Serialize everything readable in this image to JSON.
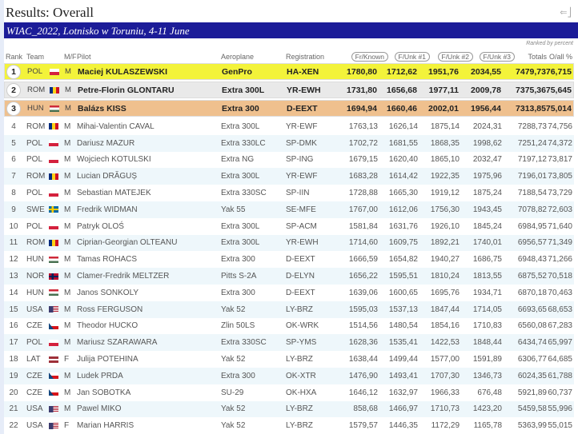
{
  "page": {
    "title": "Results: Overall",
    "exit_icon": "exit-icon",
    "banner": "WIAC_2022, Lotnisko w Toruniu, 4-11 June",
    "ranked_by": "Ranked by percent"
  },
  "colors": {
    "banner": "#1c1c98",
    "gold": "#f3f33a",
    "silver": "#e9e9e9",
    "bronze": "#efc08e",
    "alt_row": "#eef7fb"
  },
  "headers": {
    "rank": "Rank",
    "team": "Team",
    "mf": "M/F",
    "pilot": "Pilot",
    "aero": "Aeroplane",
    "reg": "Registration",
    "n1": "Fr/Known",
    "n2": "F/Unk #1",
    "n3": "F/Unk #2",
    "n4": "F/Unk #3",
    "tot": "Totals",
    "pct": "O/all %"
  },
  "rows": [
    [
      "1",
      "POL",
      "M",
      "Maciej KULASZEWSKI",
      "GenPro",
      "HA-XEN",
      "1780,80",
      "1712,62",
      "1951,76",
      "2034,55",
      "7479,73",
      "76,715"
    ],
    [
      "2",
      "ROM",
      "M",
      "Petre-Florin GLONTARU",
      "Extra 300L",
      "YR-EWH",
      "1731,80",
      "1656,68",
      "1977,11",
      "2009,78",
      "7375,36",
      "75,645"
    ],
    [
      "3",
      "HUN",
      "M",
      "Balázs KISS",
      "Extra 300",
      "D-EEXT",
      "1694,94",
      "1660,46",
      "2002,01",
      "1956,44",
      "7313,85",
      "75,014"
    ],
    [
      "4",
      "ROM",
      "M",
      "Mihai-Valentin CAVAL",
      "Extra 300L",
      "YR-EWF",
      "1763,13",
      "1626,14",
      "1875,14",
      "2024,31",
      "7288,73",
      "74,756"
    ],
    [
      "5",
      "POL",
      "M",
      "Dariusz MAZUR",
      "Extra 330LC",
      "SP-DMK",
      "1702,72",
      "1681,55",
      "1868,35",
      "1998,62",
      "7251,24",
      "74,372"
    ],
    [
      "6",
      "POL",
      "M",
      "Wojciech KOTULSKI",
      "Extra NG",
      "SP-ING",
      "1679,15",
      "1620,40",
      "1865,10",
      "2032,47",
      "7197,12",
      "73,817"
    ],
    [
      "7",
      "ROM",
      "M",
      "Lucian DRĂGUȘ",
      "Extra 300L",
      "YR-EWF",
      "1683,28",
      "1614,42",
      "1922,35",
      "1975,96",
      "7196,01",
      "73,805"
    ],
    [
      "8",
      "POL",
      "M",
      "Sebastian MATEJEK",
      "Extra 330SC",
      "SP-IIN",
      "1728,88",
      "1665,30",
      "1919,12",
      "1875,24",
      "7188,54",
      "73,729"
    ],
    [
      "9",
      "SWE",
      "M",
      "Fredrik WIDMAN",
      "Yak 55",
      "SE-MFE",
      "1767,00",
      "1612,06",
      "1756,30",
      "1943,45",
      "7078,82",
      "72,603"
    ],
    [
      "10",
      "POL",
      "M",
      "Patryk OLOŚ",
      "Extra 300L",
      "SP-ACM",
      "1581,84",
      "1631,76",
      "1926,10",
      "1845,24",
      "6984,95",
      "71,640"
    ],
    [
      "11",
      "ROM",
      "M",
      "Ciprian-Georgian OLTEANU",
      "Extra 300L",
      "YR-EWH",
      "1714,60",
      "1609,75",
      "1892,21",
      "1740,01",
      "6956,57",
      "71,349"
    ],
    [
      "12",
      "HUN",
      "M",
      "Tamas ROHACS",
      "Extra 300",
      "D-EEXT",
      "1666,59",
      "1654,82",
      "1940,27",
      "1686,75",
      "6948,43",
      "71,266"
    ],
    [
      "13",
      "NOR",
      "M",
      "Clamer-Fredrik MELTZER",
      "Pitts S-2A",
      "D-ELYN",
      "1656,22",
      "1595,51",
      "1810,24",
      "1813,55",
      "6875,52",
      "70,518"
    ],
    [
      "14",
      "HUN",
      "M",
      "Janos SONKOLY",
      "Extra 300",
      "D-EEXT",
      "1639,06",
      "1600,65",
      "1695,76",
      "1934,71",
      "6870,18",
      "70,463"
    ],
    [
      "15",
      "USA",
      "M",
      "Ross FERGUSON",
      "Yak 52",
      "LY-BRZ",
      "1595,03",
      "1537,13",
      "1847,44",
      "1714,05",
      "6693,65",
      "68,653"
    ],
    [
      "16",
      "CZE",
      "M",
      "Theodor HUCKO",
      "Zlin 50LS",
      "OK-WRK",
      "1514,56",
      "1480,54",
      "1854,16",
      "1710,83",
      "6560,08",
      "67,283"
    ],
    [
      "17",
      "POL",
      "M",
      "Mariusz SZARAWARA",
      "Extra 330SC",
      "SP-YMS",
      "1628,36",
      "1535,41",
      "1422,53",
      "1848,44",
      "6434,74",
      "65,997"
    ],
    [
      "18",
      "LAT",
      "F",
      "Julija POTEHINA",
      "Yak 52",
      "LY-BRZ",
      "1638,44",
      "1499,44",
      "1577,00",
      "1591,89",
      "6306,77",
      "64,685"
    ],
    [
      "19",
      "CZE",
      "M",
      "Ludek PRDA",
      "Extra 300",
      "OK-XTR",
      "1476,90",
      "1493,41",
      "1707,30",
      "1346,73",
      "6024,35",
      "61,788"
    ],
    [
      "20",
      "CZE",
      "M",
      "Jan SOBOTKA",
      "SU-29",
      "OK-HXA",
      "1646,12",
      "1632,97",
      "1966,33",
      "676,48",
      "5921,89",
      "60,737"
    ],
    [
      "21",
      "USA",
      "M",
      "Pawel MIKO",
      "Yak 52",
      "LY-BRZ",
      "858,68",
      "1466,97",
      "1710,73",
      "1423,20",
      "5459,58",
      "55,996"
    ],
    [
      "22",
      "USA",
      "F",
      "Marian HARRIS",
      "Yak 52",
      "LY-BRZ",
      "1579,57",
      "1446,35",
      "1172,29",
      "1165,78",
      "5363,99",
      "55,015"
    ]
  ]
}
